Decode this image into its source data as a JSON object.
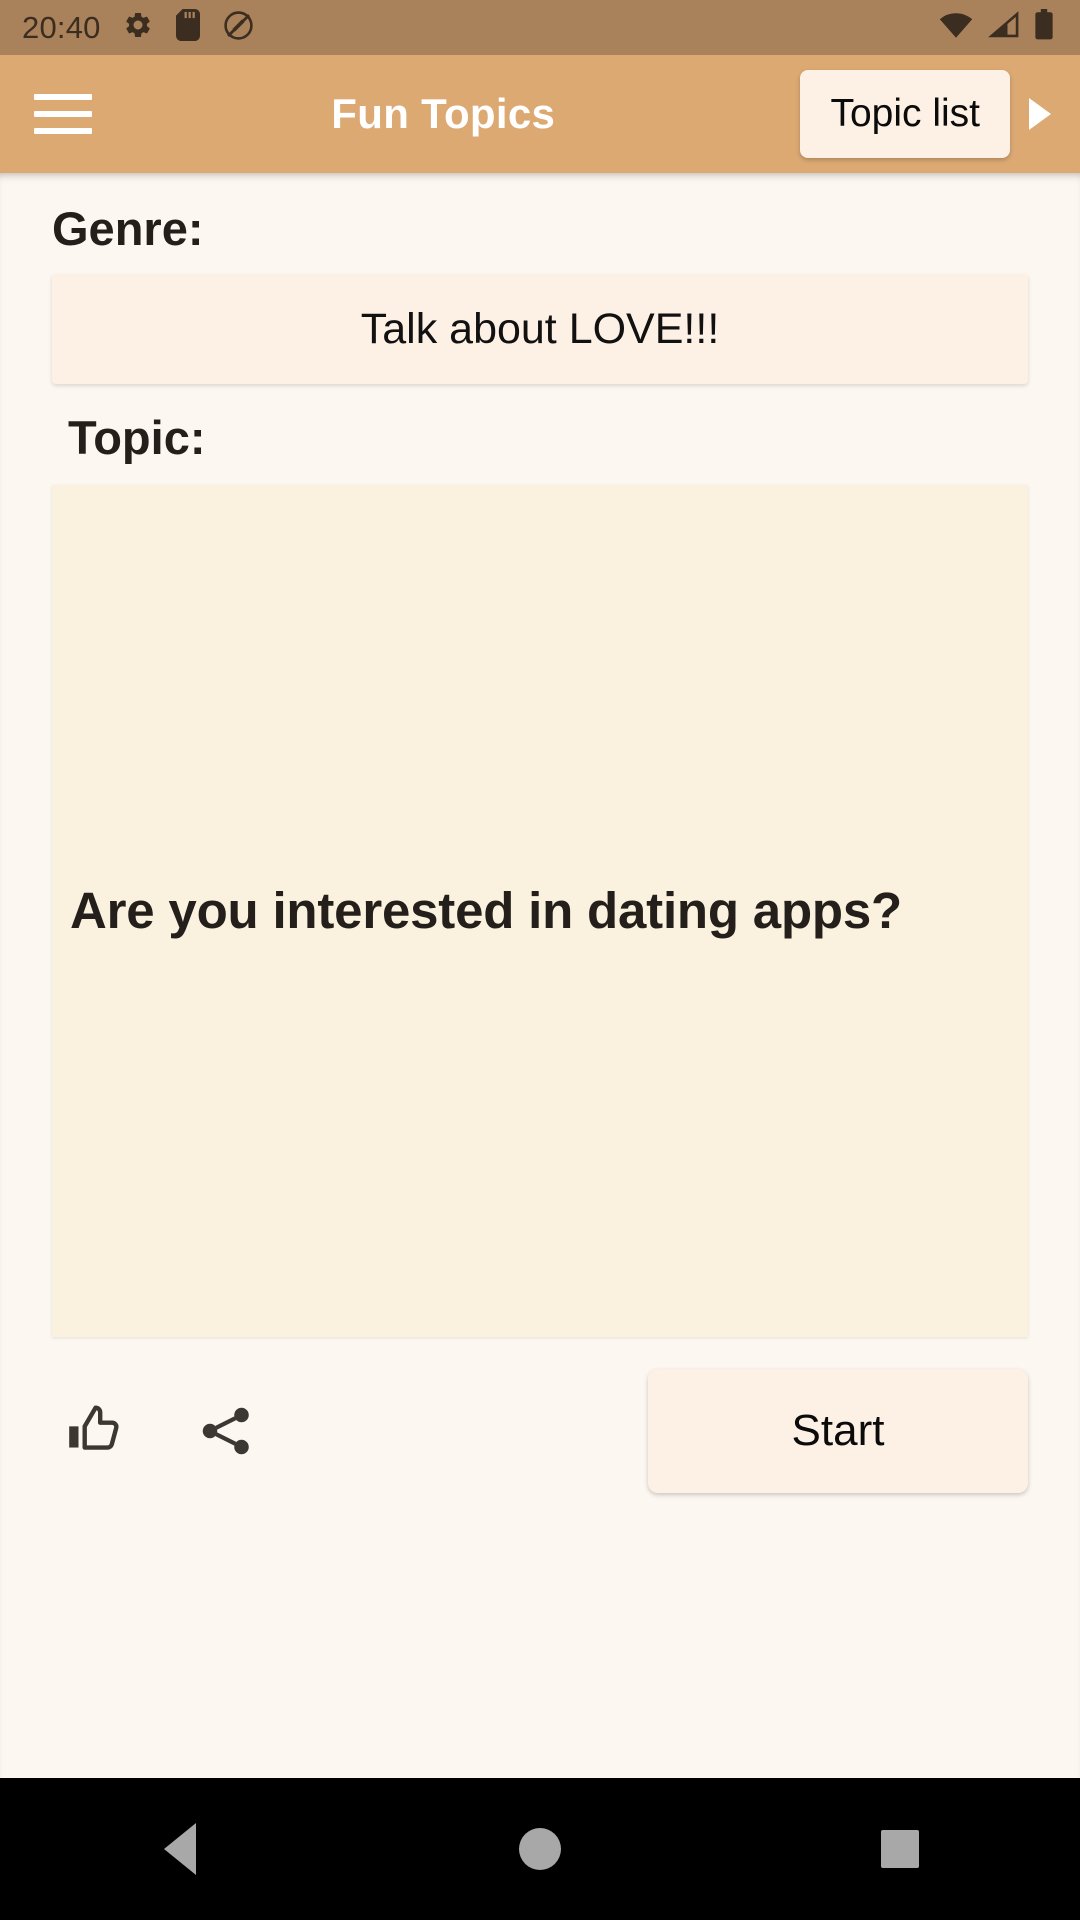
{
  "status_bar": {
    "clock": "20:40",
    "left_icons": [
      "gear-icon",
      "sd-card-icon",
      "do-not-disturb-icon"
    ],
    "right_icons": [
      "wifi-icon",
      "cellular-signal-icon",
      "battery-icon"
    ],
    "background": "#A9825B",
    "foreground": "#3B2D20"
  },
  "app_bar": {
    "menu_icon": "hamburger-menu-icon",
    "title": "Fun Topics",
    "topic_list_label": "Topic list",
    "next_icon": "play-arrow-icon",
    "background": "#DCA973",
    "title_color": "#FFFFFF"
  },
  "main": {
    "genre_label": "Genre:",
    "genre_value": "Talk about LOVE!!!",
    "topic_label": "Topic:",
    "topic_value": "Are you interested in dating apps?",
    "genre_card_bg": "#FDF1E6",
    "topic_card_bg": "#FAF2DE",
    "page_bg": "#FDF7F2"
  },
  "actions": {
    "like_icon": "thumb-up-icon",
    "share_icon": "share-icon",
    "start_label": "Start",
    "start_bg": "#FDF1E6"
  },
  "nav_bar": {
    "back_icon": "back-triangle-icon",
    "home_icon": "home-circle-icon",
    "recents_icon": "recents-square-icon",
    "background": "#000000",
    "icon_color": "#A8A8A8"
  }
}
